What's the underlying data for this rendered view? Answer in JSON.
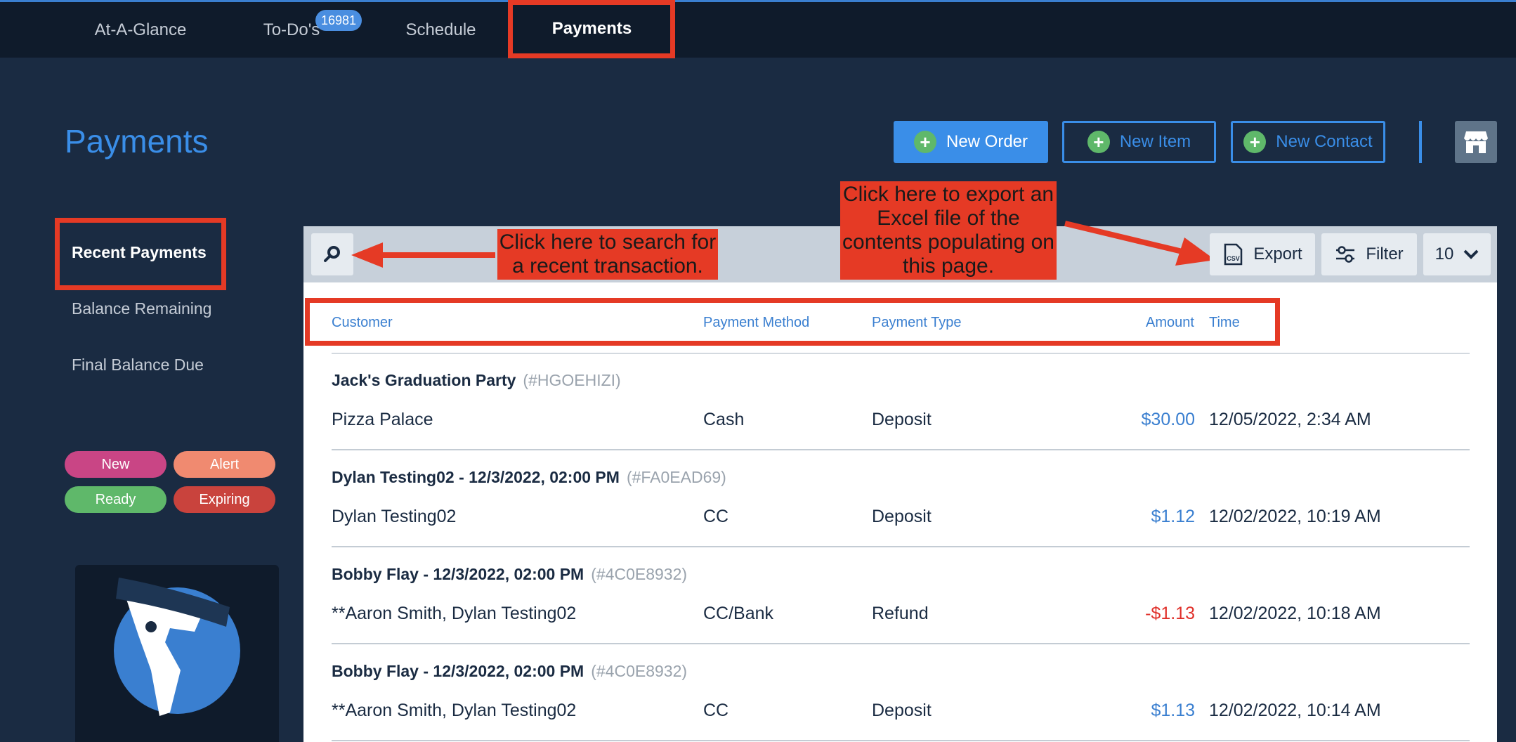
{
  "nav": {
    "tabs": [
      {
        "label": "At-A-Glance"
      },
      {
        "label": "To-Do's",
        "badge": "16981"
      },
      {
        "label": "Schedule"
      },
      {
        "label": "Payments"
      }
    ],
    "active_tab": "Payments"
  },
  "header": {
    "title": "Payments",
    "buttons": {
      "new_order": "New Order",
      "new_item": "New Item",
      "new_contact": "New Contact"
    }
  },
  "sidebar": {
    "items": [
      {
        "label": "Recent Payments"
      },
      {
        "label": "Balance Remaining"
      },
      {
        "label": "Final Balance Due"
      }
    ],
    "legend": [
      {
        "label": "New",
        "color": "#c94585"
      },
      {
        "label": "Alert",
        "color": "#f08a70"
      },
      {
        "label": "Ready",
        "color": "#5fb86a"
      },
      {
        "label": "Expiring",
        "color": "#c9433d"
      }
    ]
  },
  "toolbar": {
    "export_label": "Export",
    "export_icon_text": "CSV",
    "filter_label": "Filter",
    "page_size": "10"
  },
  "annotations": {
    "search_note": "Click here to search for a recent transaction.",
    "export_note": "Click here to export an Excel file of the contents populating on this page."
  },
  "table": {
    "columns": {
      "customer": "Customer",
      "method": "Payment Method",
      "type": "Payment Type",
      "amount": "Amount",
      "time": "Time"
    },
    "rows": [
      {
        "order": "Jack's Graduation Party",
        "code": "(#HGOEHIZI)",
        "customer": "Pizza Palace",
        "method": "Cash",
        "type": "Deposit",
        "amount": "$30.00",
        "time": "12/05/2022, 2:34 AM"
      },
      {
        "order": "Dylan Testing02 - 12/3/2022, 02:00 PM",
        "code": "(#FA0EAD69)",
        "customer": "Dylan Testing02",
        "method": "CC",
        "type": "Deposit",
        "amount": "$1.12",
        "time": "12/02/2022, 10:19 AM"
      },
      {
        "order": "Bobby Flay - 12/3/2022, 02:00 PM",
        "code": "(#4C0E8932)",
        "customer": "**Aaron Smith, Dylan Testing02",
        "method": "CC/Bank",
        "type": "Refund",
        "amount": "-$1.13",
        "time": "12/02/2022, 10:18 AM"
      },
      {
        "order": "Bobby Flay - 12/3/2022, 02:00 PM",
        "code": "(#4C0E8932)",
        "customer": "**Aaron Smith, Dylan Testing02",
        "method": "CC",
        "type": "Deposit",
        "amount": "$1.13",
        "time": "12/02/2022, 10:14 AM"
      }
    ]
  },
  "colors": {
    "accent": "#3a8ee8",
    "annotation": "#e53a25",
    "negative": "#e0302a"
  }
}
